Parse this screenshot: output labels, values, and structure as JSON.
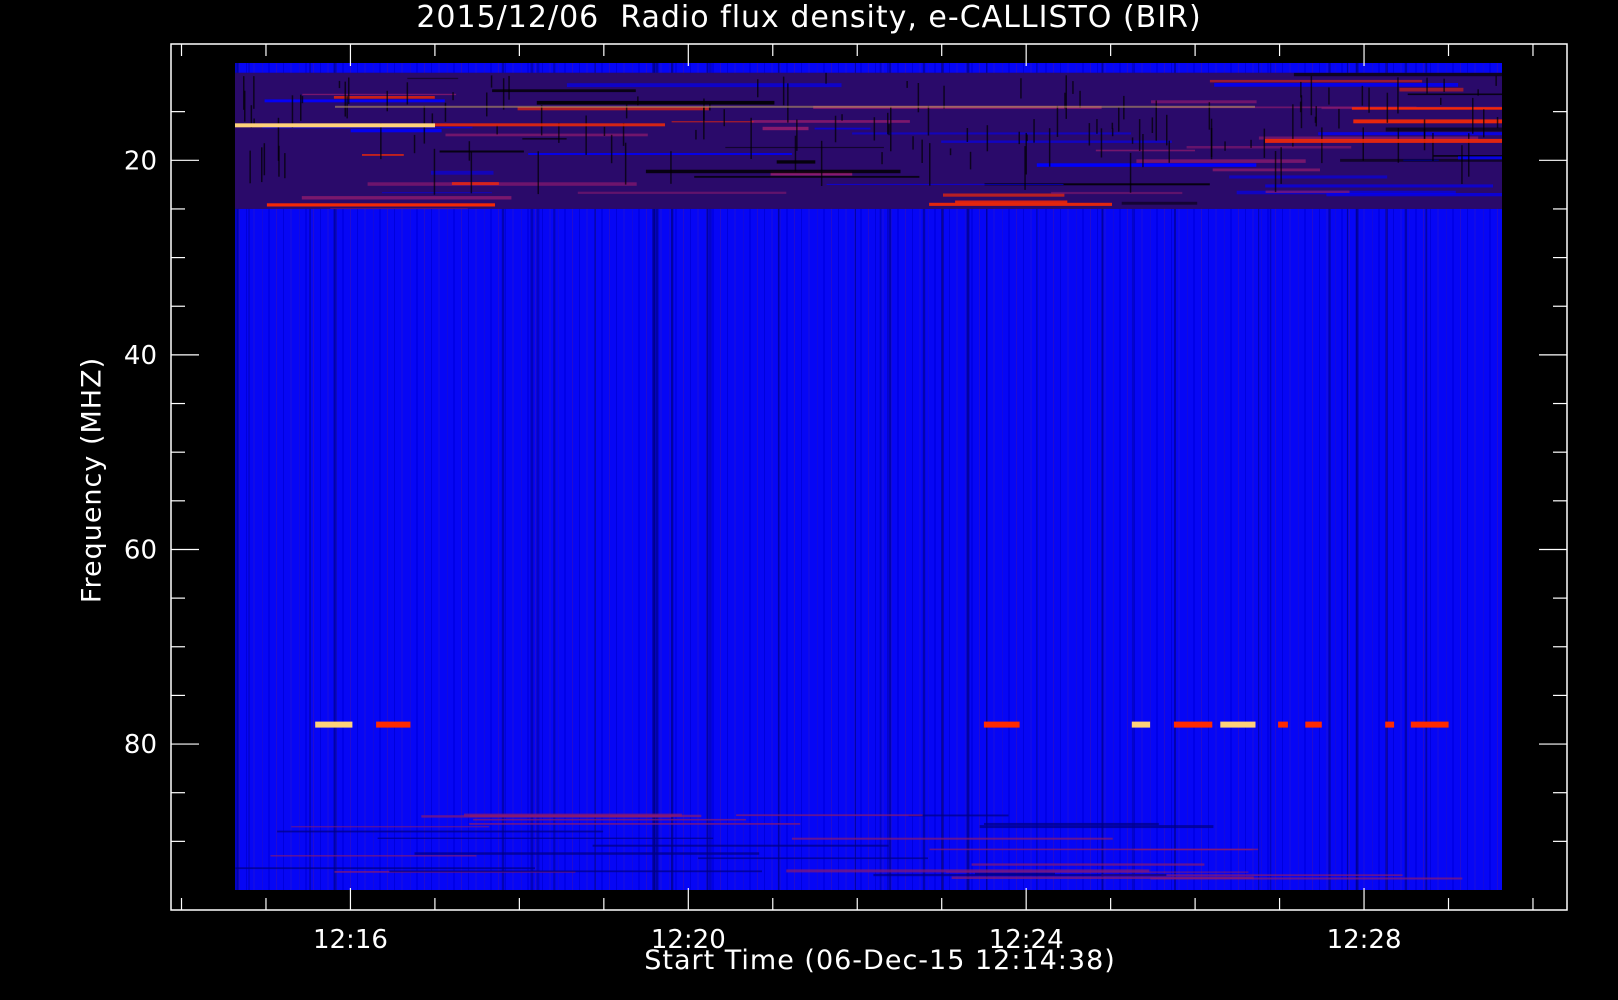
{
  "chart_data": {
    "type": "heatmap",
    "title": "2015/12/06  Radio flux density, e-CALLISTO (BIR)",
    "xlabel": "Start Time (06-Dec-15 12:14:38)",
    "ylabel": "Frequency (MHZ)",
    "x_start": "12:14:38",
    "x_end": "12:29:38",
    "x_tick_labels": [
      "12:16",
      "12:20",
      "12:24",
      "12:28"
    ],
    "y_tick_labels": [
      "20",
      "40",
      "60",
      "80"
    ],
    "ylim": [
      10,
      95
    ],
    "y_inverted": true,
    "colormap": [
      "#000000",
      "#0000ff",
      "#8a1a6e",
      "#ff2a00",
      "#ffd27a"
    ],
    "background_color": "#0000ff",
    "features": [
      {
        "name": "high-intensity band",
        "freq_range_mhz": [
          11,
          25
        ],
        "intensity": "high"
      },
      {
        "name": "interference line",
        "freq_mhz": 78,
        "intensity": "high",
        "time_segments": [
          [
            "12:15:35",
            "12:16:45"
          ],
          [
            "12:23:30",
            "12:24:00"
          ],
          [
            "12:25:15",
            "12:27:30"
          ],
          [
            "12:28:15",
            "12:29:15"
          ]
        ]
      },
      {
        "name": "low-frequency band",
        "freq_range_mhz": [
          87,
          94
        ],
        "intensity": "moderate"
      }
    ]
  }
}
